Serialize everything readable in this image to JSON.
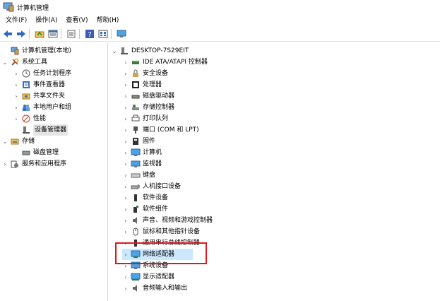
{
  "window": {
    "title": "计算机管理"
  },
  "menu": [
    "文件(F)",
    "操作(A)",
    "查看(V)",
    "帮助(H)"
  ],
  "toolbar": [
    "back-arrow-icon",
    "forward-arrow-icon",
    "up-folder-icon",
    "properties-icon",
    "help-icon",
    "list-view-icon",
    "monitor-icon"
  ],
  "left_tree": [
    {
      "label": "计算机管理(本地)",
      "level": 0,
      "expand": "none",
      "icon": "computer-mgmt"
    },
    {
      "label": "系统工具",
      "level": 0,
      "expand": "open",
      "icon": "tools"
    },
    {
      "label": "任务计划程序",
      "level": 1,
      "expand": "closed",
      "icon": "clock"
    },
    {
      "label": "事件查看器",
      "level": 1,
      "expand": "closed",
      "icon": "event-log"
    },
    {
      "label": "共享文件夹",
      "level": 1,
      "expand": "closed",
      "icon": "folder-share"
    },
    {
      "label": "本地用户和组",
      "level": 1,
      "expand": "closed",
      "icon": "users"
    },
    {
      "label": "性能",
      "level": 1,
      "expand": "closed",
      "icon": "performance"
    },
    {
      "label": "设备管理器",
      "level": 1,
      "expand": "none",
      "icon": "device-mgr",
      "selected": true
    },
    {
      "label": "存储",
      "level": 0,
      "expand": "open",
      "icon": "storage"
    },
    {
      "label": "磁盘管理",
      "level": 1,
      "expand": "none",
      "icon": "disk"
    },
    {
      "label": "服务和应用程序",
      "level": 0,
      "expand": "closed",
      "icon": "services"
    }
  ],
  "right_tree": {
    "root": "DESKTOP-7S29EIT",
    "items": [
      {
        "label": "IDE ATA/ATAPI 控制器",
        "icon": "ide-controller"
      },
      {
        "label": "安全设备",
        "icon": "security"
      },
      {
        "label": "处理器",
        "icon": "cpu"
      },
      {
        "label": "磁盘驱动器",
        "icon": "disk-drive"
      },
      {
        "label": "存储控制器",
        "icon": "storage-controller"
      },
      {
        "label": "打印队列",
        "icon": "printer"
      },
      {
        "label": "端口 (COM 和 LPT)",
        "icon": "port"
      },
      {
        "label": "固件",
        "icon": "firmware"
      },
      {
        "label": "计算机",
        "icon": "computer"
      },
      {
        "label": "监视器",
        "icon": "monitor"
      },
      {
        "label": "键盘",
        "icon": "keyboard"
      },
      {
        "label": "人机接口设备",
        "icon": "hid"
      },
      {
        "label": "软件设备",
        "icon": "software-device"
      },
      {
        "label": "软件组件",
        "icon": "software-component"
      },
      {
        "label": "声音、视频和游戏控制器",
        "icon": "sound"
      },
      {
        "label": "鼠标和其他指针设备",
        "icon": "mouse"
      },
      {
        "label": "通用串行总线控制器",
        "icon": "usb"
      },
      {
        "label": "网络适配器",
        "icon": "network-adapter",
        "highlight": true
      },
      {
        "label": "系统设备",
        "icon": "system-device"
      },
      {
        "label": "显示适配器",
        "icon": "display-adapter"
      },
      {
        "label": "音频输入和输出",
        "icon": "audio"
      }
    ]
  },
  "colors": {
    "highlight_box": "#e0161b",
    "selection": "#cce8ff",
    "monitor_blue": "#1e88e5"
  }
}
